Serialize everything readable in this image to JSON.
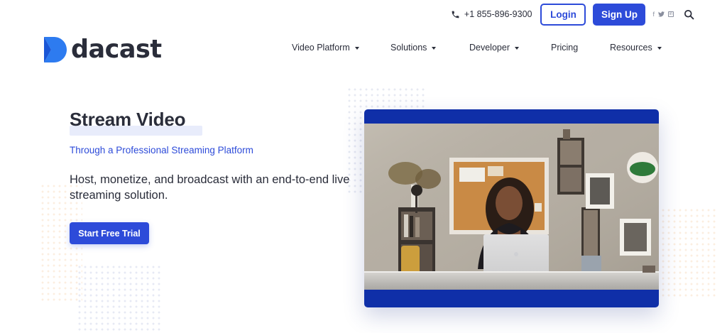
{
  "header": {
    "phone": "+1 855-896-9300",
    "login_label": "Login",
    "signup_label": "Sign Up",
    "social": {
      "facebook": "f",
      "twitter": "t",
      "linkedin": "in"
    }
  },
  "logo": {
    "text": "dacast",
    "mark_color": "#2d7bf0"
  },
  "nav": {
    "items": [
      {
        "label": "Video Platform",
        "dropdown": true
      },
      {
        "label": "Solutions",
        "dropdown": true
      },
      {
        "label": "Developer",
        "dropdown": true
      },
      {
        "label": "Pricing",
        "dropdown": false
      },
      {
        "label": "Resources",
        "dropdown": true
      }
    ]
  },
  "hero": {
    "title": "Stream Video",
    "subtitle": "Through a Professional Streaming Platform",
    "description": "Host, monetize, and broadcast with an end-to-end live streaming solution.",
    "cta_label": "Start Free Trial"
  },
  "colors": {
    "accent": "#2d4bd9",
    "video_frame": "#0f2fa8",
    "text": "#2a2d3a"
  }
}
